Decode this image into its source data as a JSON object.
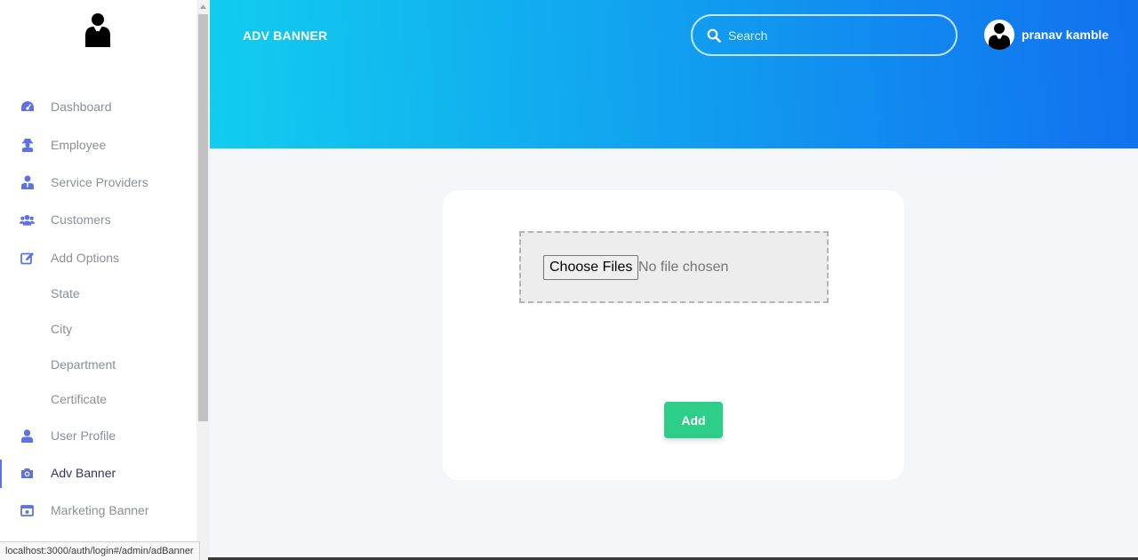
{
  "sidebar": {
    "logo_icon": "businessman-icon",
    "items": [
      {
        "label": "Dashboard",
        "icon": "tachometer-icon",
        "color": "#5e72e4"
      },
      {
        "label": "Employee",
        "icon": "user-secret-icon",
        "color": "#5e72e4"
      },
      {
        "label": "Service Providers",
        "icon": "user-tie-icon",
        "color": "#5e72e4"
      },
      {
        "label": "Customers",
        "icon": "users-icon",
        "color": "#5e72e4"
      },
      {
        "label": "Add Options",
        "icon": "edit-icon",
        "color": "#5e72e4"
      },
      {
        "label": "State"
      },
      {
        "label": "City"
      },
      {
        "label": "Department"
      },
      {
        "label": "Certificate"
      },
      {
        "label": "User Profile",
        "icon": "user-icon",
        "color": "#5e72e4"
      },
      {
        "label": "Adv Banner",
        "icon": "camera-icon",
        "color": "#5e72e4",
        "active": true
      },
      {
        "label": "Marketing Banner",
        "icon": "image-icon",
        "color": "#5e72e4"
      }
    ]
  },
  "header": {
    "title": "ADV BANNER",
    "search_placeholder": "Search",
    "user_name": "pranav kamble",
    "gradient": [
      "#11cdef",
      "#1171ef"
    ]
  },
  "upload": {
    "choose_label": "Choose Files",
    "status": "No file chosen"
  },
  "actions": {
    "add_label": "Add",
    "add_color": "#2dce89"
  },
  "status_bar": {
    "url": "localhost:3000/auth/login#/admin/adBanner"
  }
}
